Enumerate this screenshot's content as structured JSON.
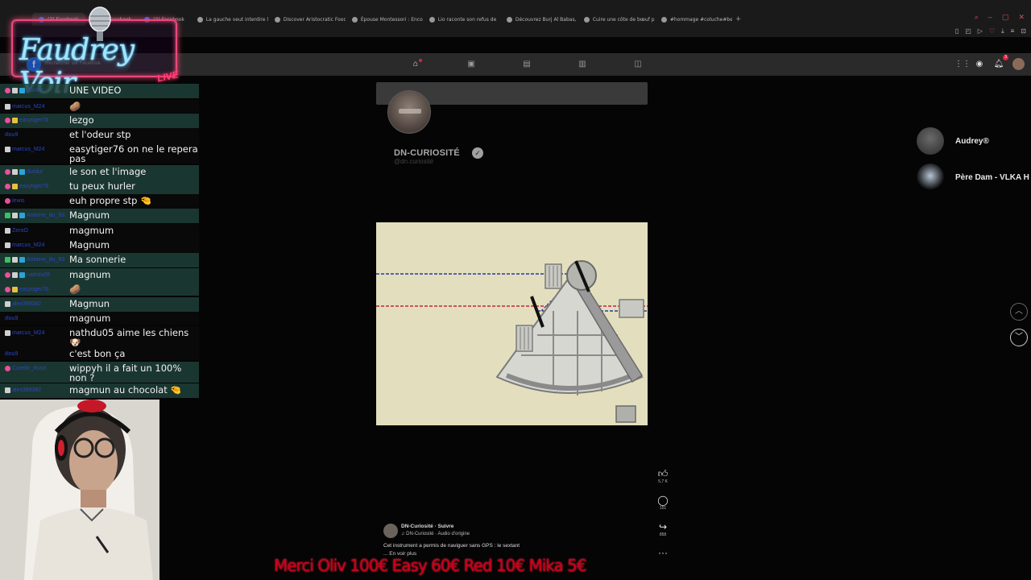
{
  "browser": {
    "tabs": [
      {
        "label": "(3) Facebook",
        "active": true,
        "icon": "facebook-favicon"
      },
      {
        "label": "(3) Facebook",
        "active": false,
        "icon": "facebook-favicon"
      },
      {
        "label": "(3) Facebook",
        "active": false,
        "icon": "facebook-favicon"
      },
      {
        "label": "La gauche veut interdire l",
        "active": false,
        "icon": "page-favicon"
      },
      {
        "label": "Discover Aristocratic Food",
        "active": false,
        "icon": "page-favicon"
      },
      {
        "label": "Épouse Montessori : Enco",
        "active": false,
        "icon": "page-favicon"
      },
      {
        "label": "Lio raconte son refus de",
        "active": false,
        "icon": "page-favicon"
      },
      {
        "label": "Découvrez Burj Al Babas,",
        "active": false,
        "icon": "page-favicon"
      },
      {
        "label": "Cuire une côte de bœuf p",
        "active": false,
        "icon": "page-favicon"
      },
      {
        "label": "#hommage #coluche#bea",
        "active": false,
        "icon": "page-favicon"
      }
    ],
    "new_tab": "+"
  },
  "facebook": {
    "search_placeholder": "Rechercher sur Facebook",
    "logo": "f",
    "notification_count": "3"
  },
  "overlay": {
    "logo_text": "Faudrey Voir",
    "logo_badge": "LIVE"
  },
  "chat": [
    {
      "user": "durdur",
      "badges": [
        "pink",
        "white",
        "blue"
      ],
      "message": "UNE VIDEO",
      "style": "alt"
    },
    {
      "user": "marcus_M24",
      "badges": [
        "white"
      ],
      "message": "🥔",
      "style": "plain"
    },
    {
      "user": "easytiger76",
      "badges": [
        "pink",
        "yellow"
      ],
      "message": "lezgo",
      "style": "alt"
    },
    {
      "user": "illou9",
      "badges": [],
      "message": "et l'odeur stp",
      "style": "plain"
    },
    {
      "user": "marcus_M24",
      "badges": [
        "white"
      ],
      "message": "easytiger76 on ne le repera pas",
      "style": "plain"
    },
    {
      "user": "durdur",
      "badges": [
        "pink",
        "white",
        "blue"
      ],
      "message": "le son et l'image",
      "style": "alt"
    },
    {
      "user": "easytiger76",
      "badges": [
        "pink",
        "yellow"
      ],
      "message": "tu peux hurler",
      "style": "alt"
    },
    {
      "user": "lewis",
      "badges": [
        "pink"
      ],
      "message": "euh propre stp 🤏",
      "style": "plain"
    },
    {
      "user": "Antoine_du_93",
      "badges": [
        "green",
        "white",
        "blue"
      ],
      "message": "Magnum",
      "style": "alt"
    },
    {
      "user": "ZeroO",
      "badges": [
        "white"
      ],
      "message": "magmum",
      "style": "plain"
    },
    {
      "user": "marcus_M24",
      "badges": [
        "white"
      ],
      "message": "Magnum",
      "style": "plain"
    },
    {
      "user": "Antoine_du_93",
      "badges": [
        "green",
        "white",
        "blue"
      ],
      "message": "Ma sonnerie",
      "style": "alt"
    },
    {
      "user": "nathdu05",
      "badges": [
        "pink",
        "white",
        "blue"
      ],
      "message": "magnum",
      "style": "alt"
    },
    {
      "user": "easytiger76",
      "badges": [
        "pink",
        "yellow"
      ],
      "message": "🥔",
      "style": "alt"
    },
    {
      "user": "alex399382",
      "badges": [
        "white"
      ],
      "message": "Magmun",
      "style": "alt"
    },
    {
      "user": "illou9",
      "badges": [],
      "message": "magnum",
      "style": "plain"
    },
    {
      "user": "marcus_M24",
      "badges": [
        "white"
      ],
      "message": "nathdu05 aime les chiens 🐶",
      "style": "plain"
    },
    {
      "user": "illou9",
      "badges": [],
      "message": "c'est bon ça",
      "style": "plain"
    },
    {
      "user": "Corello_Rush",
      "badges": [
        "pink"
      ],
      "message": "wippyh il a fait un 100% non ?",
      "style": "alt"
    },
    {
      "user": "alex399382",
      "badges": [
        "white"
      ],
      "message": "magmun au chocolat 🤏",
      "style": "alt"
    }
  ],
  "post": {
    "page_name": "DN-CURIOSITÉ",
    "page_handle": "@dn.curiosité",
    "likes": "5,7 K",
    "comments": "151",
    "shares": "858",
    "info_name": "DN-Curiosité · Suivre",
    "info_audio": "♫ DN-Curiosité · Audio d'origine",
    "info_desc": "Cet instrument a permis de naviguer sans GPS : le sextant",
    "info_more": "... En voir plus",
    "more_label": "···"
  },
  "contacts": [
    {
      "name": "Audrey®"
    },
    {
      "name": "Père Dam - VLKA H"
    }
  ],
  "ticker": "Merci  Oliv 100€  Easy 60€  Red 10€  Mika 5€",
  "colors": {
    "accent_pink": "#e84a7a",
    "chat_alt_bg": "#1e4038",
    "ticker_red": "#c8001a",
    "video_bg": "#e3dfbe"
  }
}
